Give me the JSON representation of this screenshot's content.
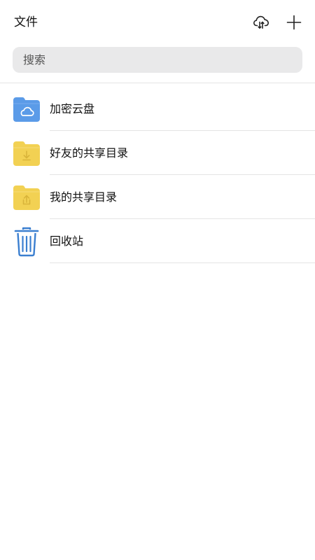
{
  "header": {
    "title": "文件",
    "cloud_icon": "cloud-sync-icon",
    "add_icon": "plus-icon"
  },
  "search": {
    "placeholder": "搜索"
  },
  "items": [
    {
      "label": "加密云盘",
      "icon": "encrypted-cloud-folder-icon",
      "color": "#5b9be8"
    },
    {
      "label": "好友的共享目录",
      "icon": "download-folder-icon",
      "color": "#f2d153"
    },
    {
      "label": "我的共享目录",
      "icon": "upload-folder-icon",
      "color": "#f2d153"
    },
    {
      "label": "回收站",
      "icon": "trash-icon",
      "color": "#3b7fd0"
    }
  ]
}
